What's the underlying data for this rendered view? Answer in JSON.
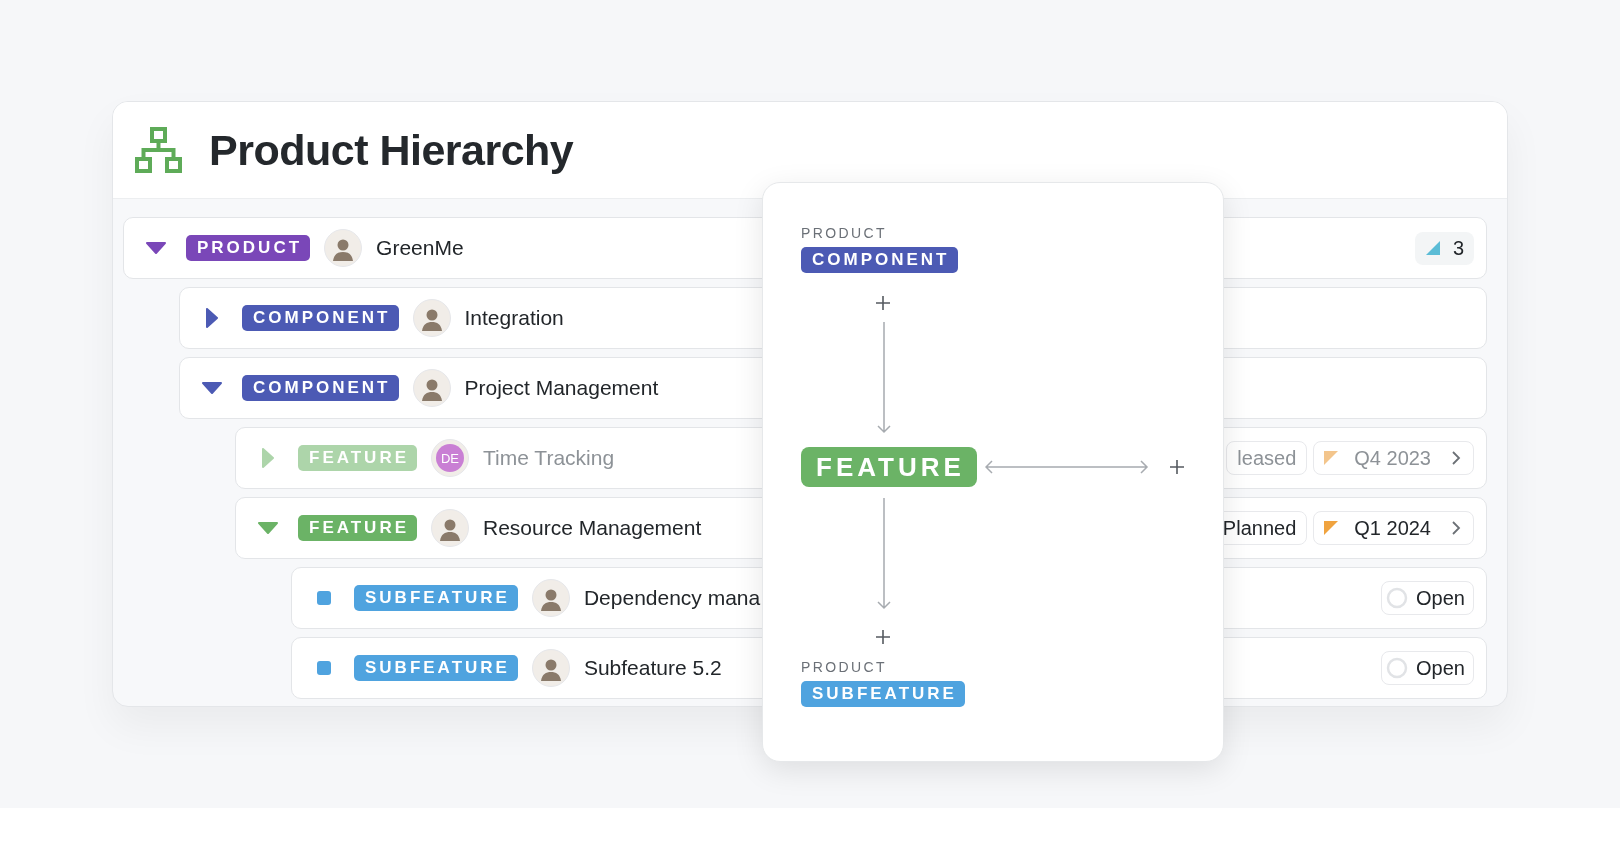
{
  "header": {
    "title": "Product Hierarchy"
  },
  "rows": [
    {
      "kind": "product",
      "badge": "PRODUCT",
      "expanded": true,
      "dimmed": false,
      "avatar": {
        "kind": "photo"
      },
      "name": "GreenMe",
      "meta": [
        {
          "kind": "count",
          "text": "3"
        }
      ],
      "children": [
        {
          "kind": "component",
          "badge": "COMPONENT",
          "expanded": false,
          "dimmed": false,
          "avatar": {
            "kind": "photo"
          },
          "name": "Integration"
        },
        {
          "kind": "component",
          "badge": "COMPONENT",
          "expanded": true,
          "dimmed": false,
          "avatar": {
            "kind": "photo"
          },
          "name": "Project Management",
          "children": [
            {
              "kind": "feature",
              "badge": "FEATURE",
              "expanded": false,
              "dimmed": true,
              "avatar": {
                "kind": "initials",
                "text": "DE"
              },
              "name": "Time Tracking",
              "meta": [
                {
                  "kind": "status",
                  "text": "leased"
                },
                {
                  "kind": "quarter",
                  "text": "Q4 2023"
                }
              ]
            },
            {
              "kind": "feature",
              "badge": "FEATURE",
              "expanded": true,
              "dimmed": false,
              "avatar": {
                "kind": "photo"
              },
              "name": "Resource Management",
              "meta": [
                {
                  "kind": "status",
                  "text": "Planned"
                },
                {
                  "kind": "quarter",
                  "text": "Q1 2024"
                }
              ],
              "children": [
                {
                  "kind": "subfeature",
                  "badge": "SUBFEATURE",
                  "dimmed": false,
                  "avatar": {
                    "kind": "photo"
                  },
                  "name": "Dependency mana",
                  "meta": [
                    {
                      "kind": "state",
                      "text": "Open"
                    }
                  ]
                },
                {
                  "kind": "subfeature",
                  "badge": "SUBFEATURE",
                  "dimmed": false,
                  "avatar": {
                    "kind": "photo"
                  },
                  "name": "Subfeature 5.2",
                  "meta": [
                    {
                      "kind": "state",
                      "text": "Open"
                    }
                  ]
                }
              ]
            }
          ]
        }
      ]
    }
  ],
  "popover": {
    "top": {
      "label": "PRODUCT",
      "kind": "component",
      "badge": "COMPONENT"
    },
    "center": {
      "kind": "feature",
      "badge": "FEATURE"
    },
    "bottom": {
      "label": "PRODUCT",
      "kind": "subfeature",
      "badge": "SUBFEATURE"
    }
  }
}
